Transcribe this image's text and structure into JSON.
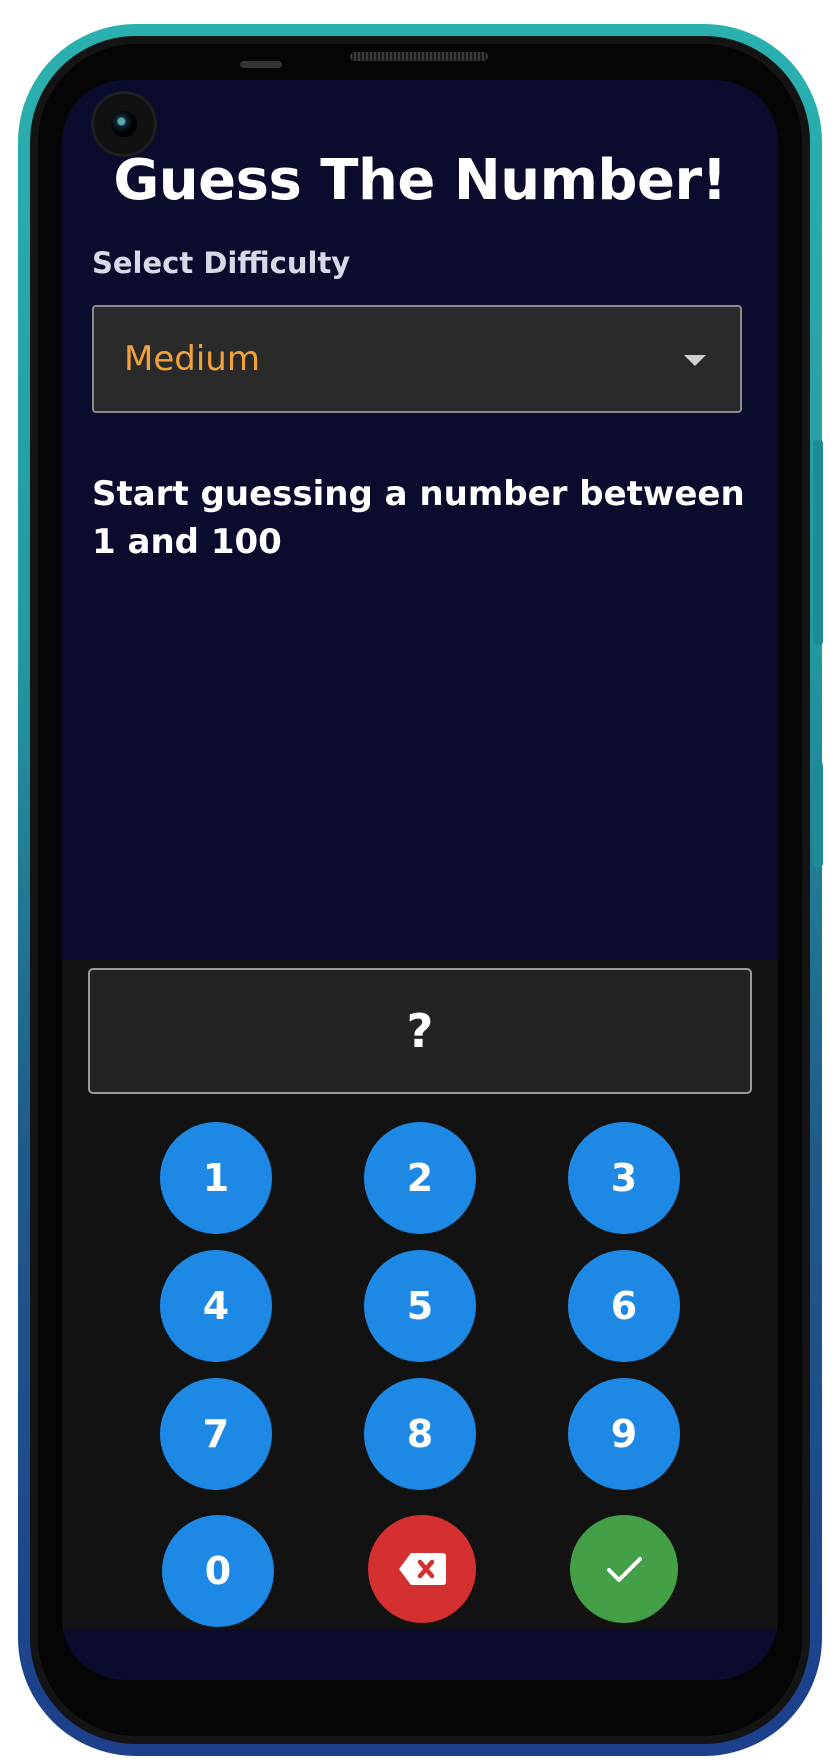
{
  "app": {
    "title": "Guess The Number!"
  },
  "difficulty": {
    "label": "Select Difficulty",
    "selected": "Medium"
  },
  "instruction": "Start guessing a number between 1 and 100",
  "guess": {
    "display": "?"
  },
  "keypad": {
    "keys": [
      "1",
      "2",
      "3",
      "4",
      "5",
      "6",
      "7",
      "8",
      "9",
      "0"
    ],
    "backspace_icon": "backspace-icon",
    "submit_icon": "check-icon"
  },
  "colors": {
    "background": "#0a0b2d",
    "keypad_panel": "#121212",
    "digit_key": "#1e88e5",
    "backspace_key": "#d3302f",
    "submit_key": "#43a047",
    "selected_text": "#f2a23a"
  }
}
